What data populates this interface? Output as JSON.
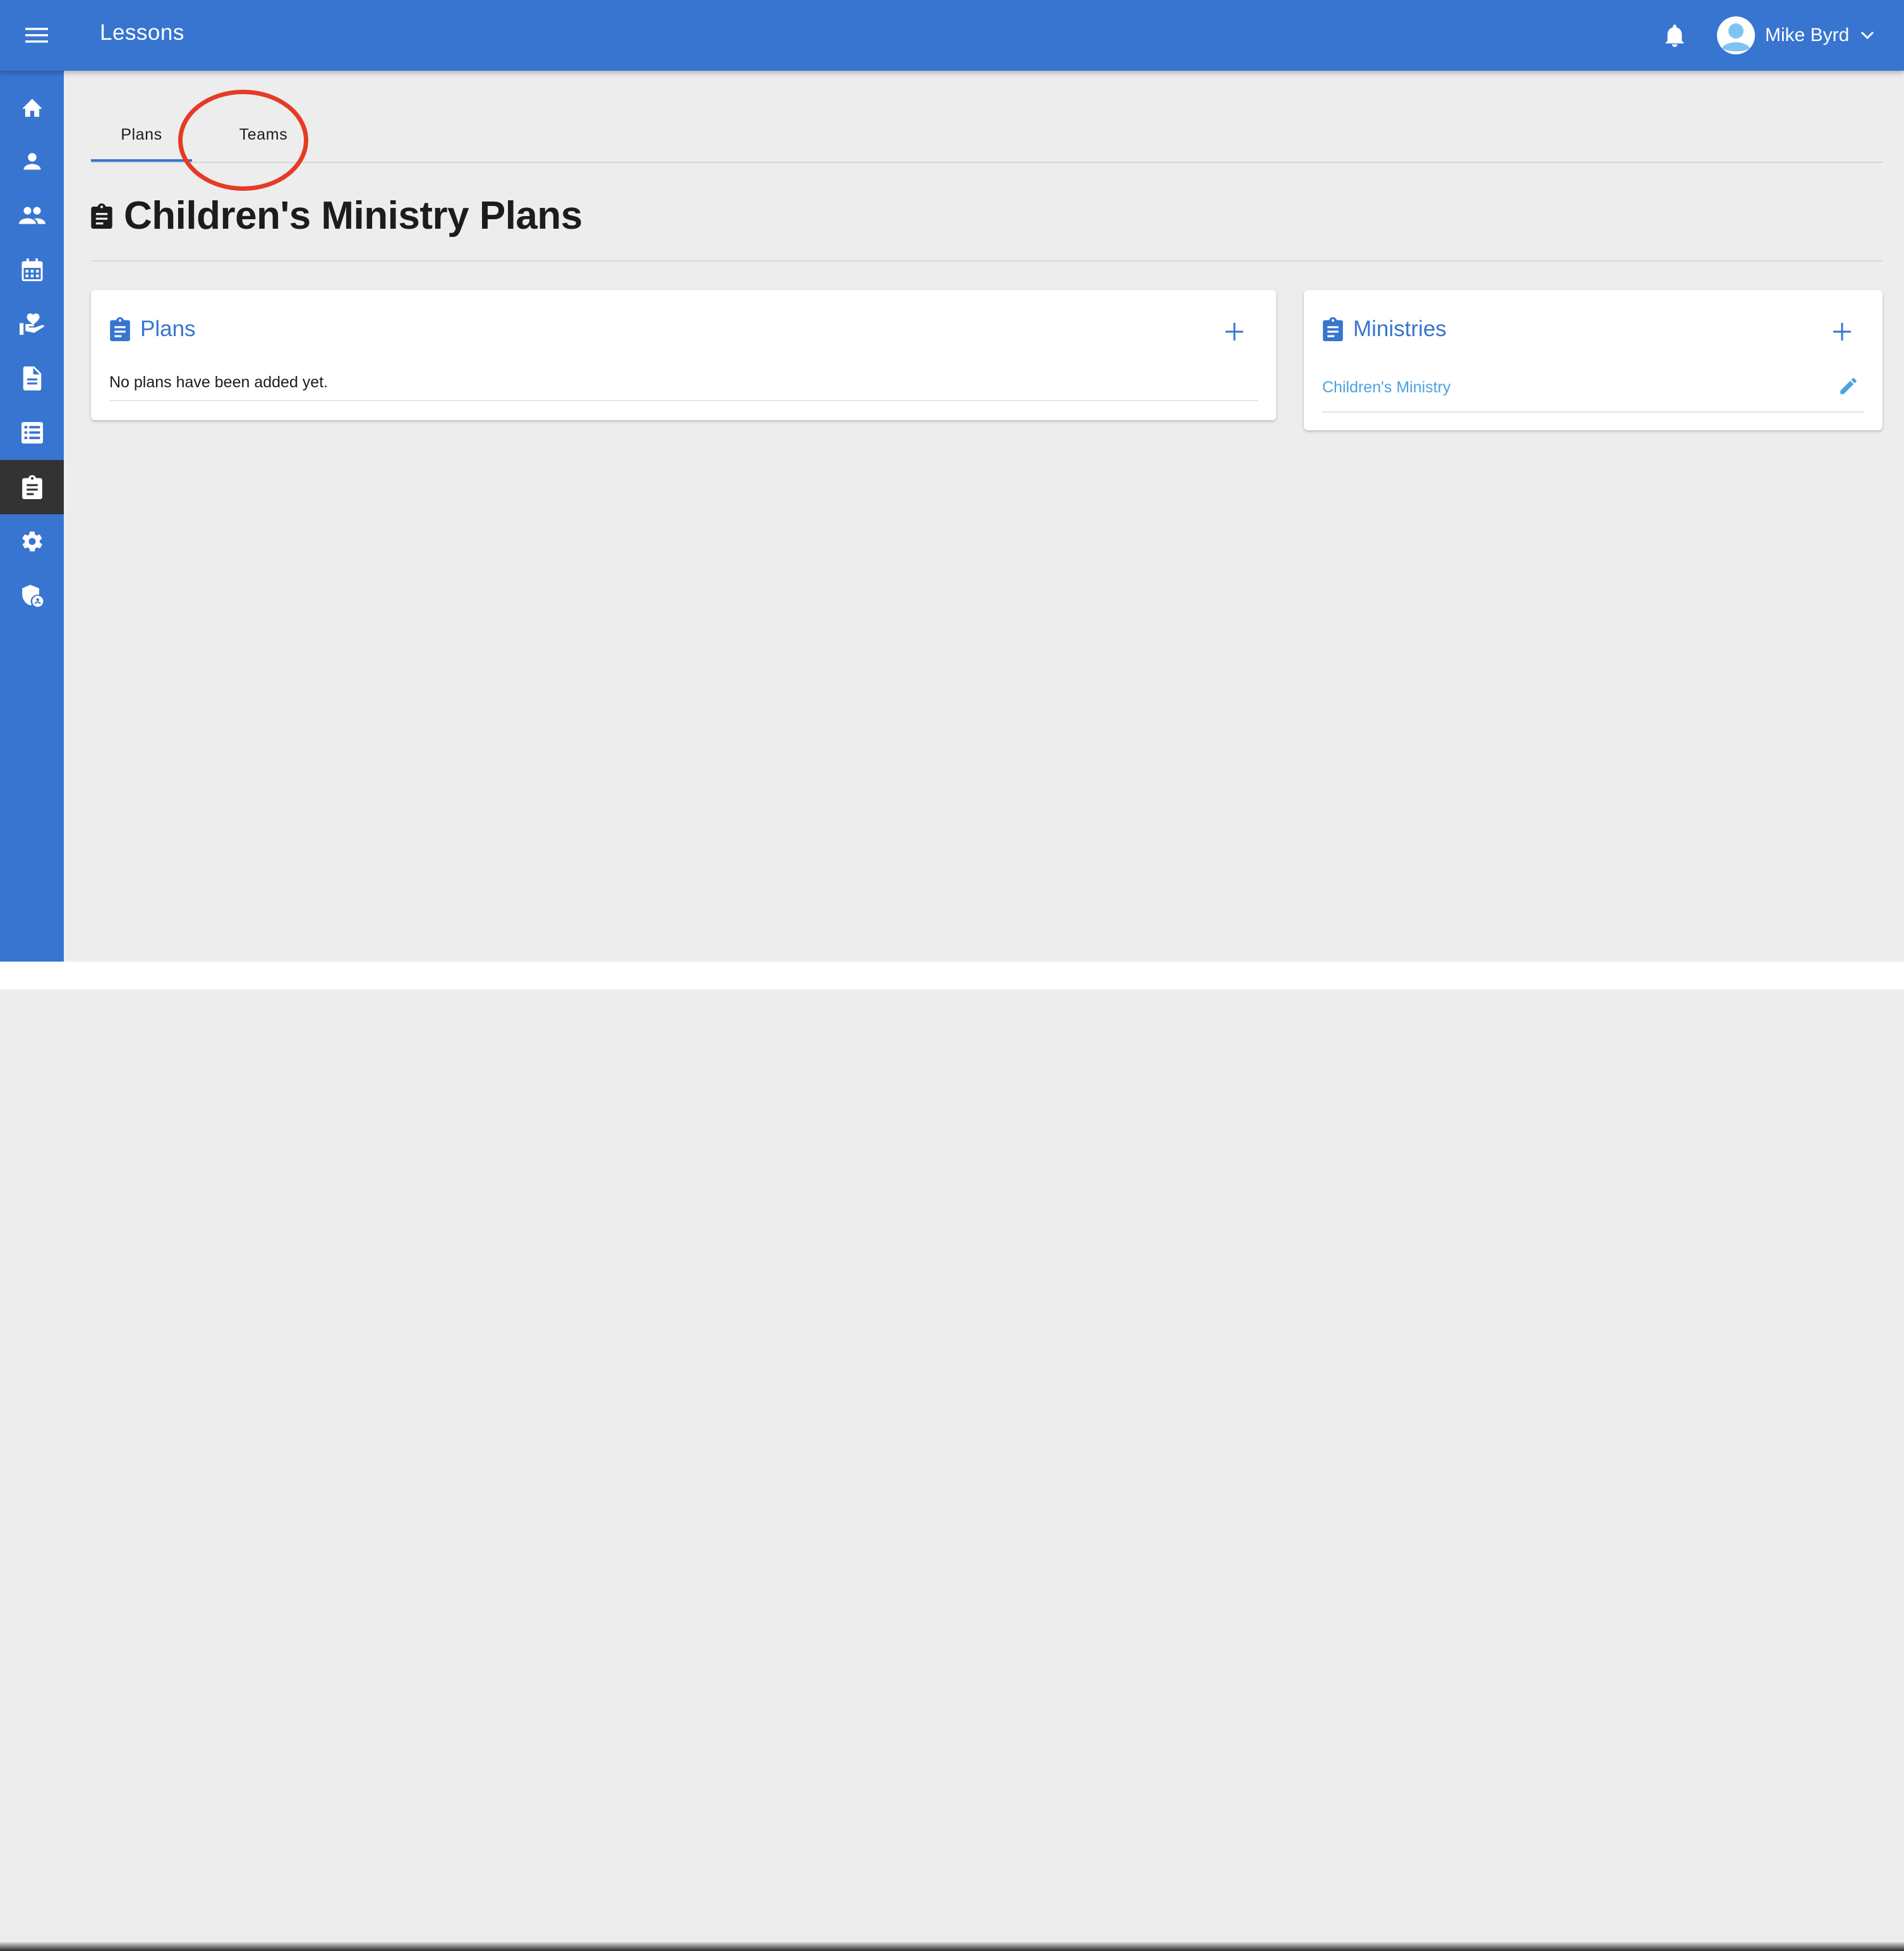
{
  "appbar": {
    "title": "Lessons",
    "user_name": "Mike Byrd",
    "icons": [
      "menu-icon",
      "bell-icon",
      "account-circle-icon",
      "chevron-down-icon"
    ]
  },
  "sidebar": {
    "items": [
      {
        "icon": "home-icon",
        "active": false
      },
      {
        "icon": "person-icon",
        "active": false
      },
      {
        "icon": "people-icon",
        "active": false
      },
      {
        "icon": "calendar-icon",
        "active": false
      },
      {
        "icon": "volunteer-heart-icon",
        "active": false
      },
      {
        "icon": "document-icon",
        "active": false
      },
      {
        "icon": "list-icon",
        "active": false
      },
      {
        "icon": "clipboard-icon",
        "active": true
      },
      {
        "icon": "gear-icon",
        "active": false
      },
      {
        "icon": "admin-shield-icon",
        "active": false
      }
    ]
  },
  "tabs": [
    {
      "label": "Plans",
      "active": true
    },
    {
      "label": "Teams",
      "active": false,
      "highlighted": true
    }
  ],
  "page": {
    "title": "Children's Ministry Plans"
  },
  "plans_card": {
    "title": "Plans",
    "empty_text": "No plans have been added yet."
  },
  "ministries_card": {
    "title": "Ministries",
    "items": [
      {
        "name": "Children's Ministry"
      }
    ]
  },
  "colors": {
    "primary": "#3875d0",
    "sidebar_active": "#333333",
    "background": "#ededed",
    "link": "#4aa3df",
    "highlight_circle": "#e53b26"
  }
}
